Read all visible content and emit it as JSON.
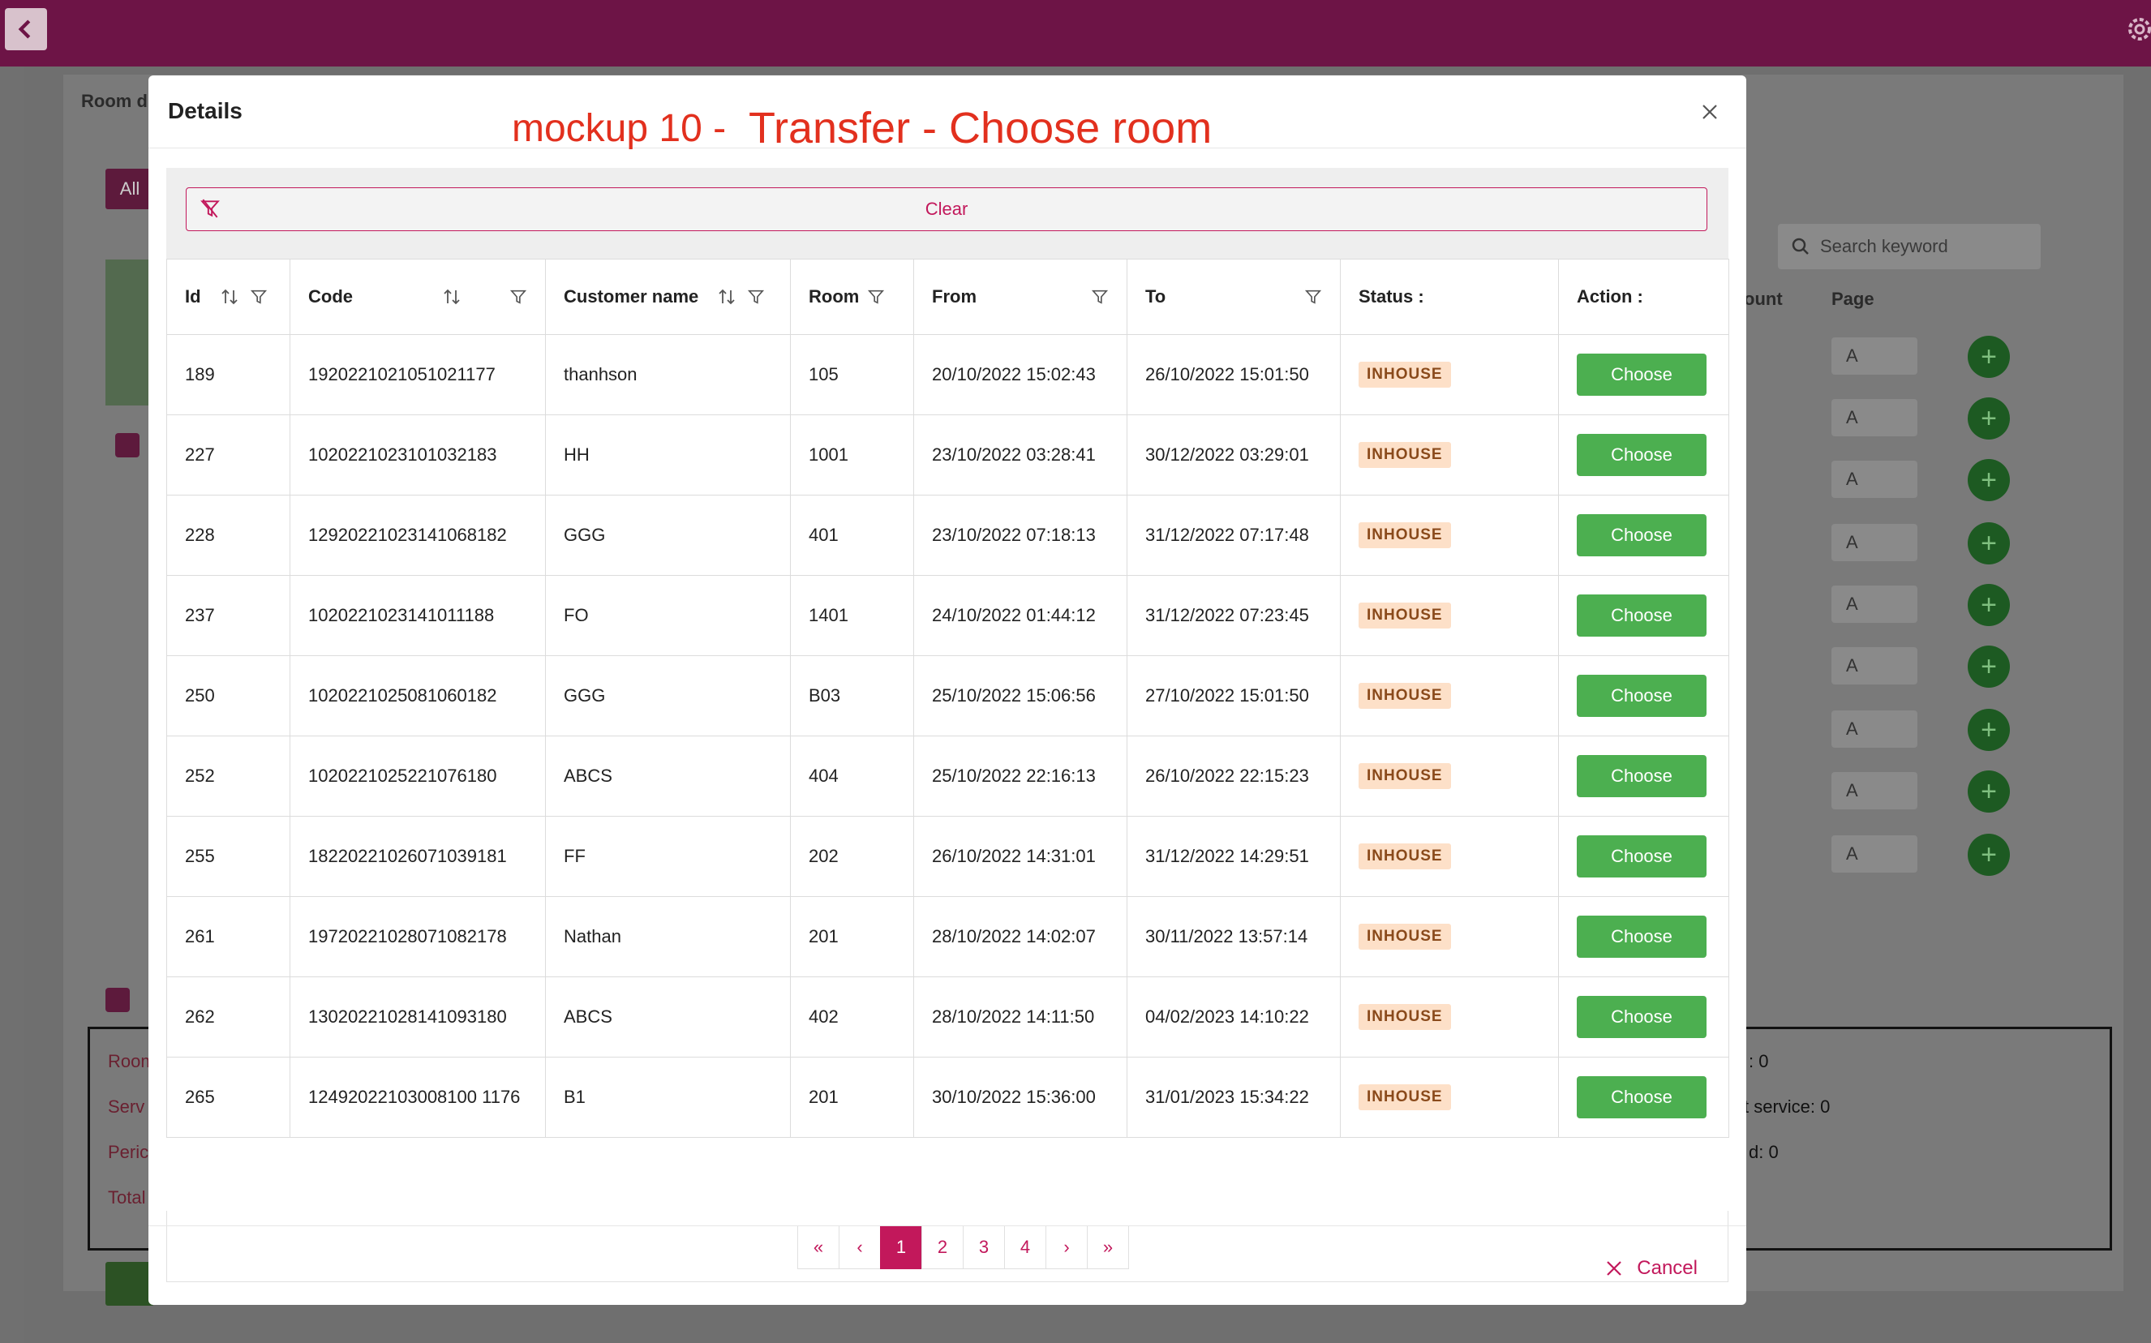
{
  "background": {
    "room_label": "Room d",
    "all_label": "All",
    "search_placeholder": "Search keyword",
    "col_amount": "ount",
    "col_page": "Page",
    "select_value": "A",
    "summary": {
      "labels": [
        "Room",
        "Serv",
        "Peric",
        "Total"
      ],
      "right": [
        ": 0",
        "t service: 0",
        "d: 0"
      ]
    },
    "check_label": "A"
  },
  "modal": {
    "title": "Details",
    "note_left": "mockup 10 -",
    "note_right": "Transfer - Choose room",
    "clear_label": "Clear",
    "cancel_label": "Cancel",
    "columns": {
      "id": "Id",
      "code": "Code",
      "customer": "Customer name",
      "room": "Room",
      "from": "From",
      "to": "To",
      "status": "Status :",
      "action": "Action :"
    },
    "choose_label": "Choose",
    "rows": [
      {
        "id": "189",
        "code": "1920221021051021177",
        "customer": "thanhson",
        "room": "105",
        "from": "20/10/2022 15:02:43",
        "to": "26/10/2022 15:01:50",
        "status": "INHOUSE"
      },
      {
        "id": "227",
        "code": "1020221023101032183",
        "customer": "HH",
        "room": "1001",
        "from": "23/10/2022 03:28:41",
        "to": "30/12/2022 03:29:01",
        "status": "INHOUSE"
      },
      {
        "id": "228",
        "code": "12920221023141068182",
        "customer": "GGG",
        "room": "401",
        "from": "23/10/2022 07:18:13",
        "to": "31/12/2022 07:17:48",
        "status": "INHOUSE"
      },
      {
        "id": "237",
        "code": "1020221023141011188",
        "customer": "FO",
        "room": "1401",
        "from": "24/10/2022 01:44:12",
        "to": "31/12/2022 07:23:45",
        "status": "INHOUSE"
      },
      {
        "id": "250",
        "code": "1020221025081060182",
        "customer": "GGG",
        "room": "B03",
        "from": "25/10/2022 15:06:56",
        "to": "27/10/2022 15:01:50",
        "status": "INHOUSE"
      },
      {
        "id": "252",
        "code": "1020221025221076180",
        "customer": "ABCS",
        "room": "404",
        "from": "25/10/2022 22:16:13",
        "to": "26/10/2022 22:15:23",
        "status": "INHOUSE"
      },
      {
        "id": "255",
        "code": "18220221026071039181",
        "customer": "FF",
        "room": "202",
        "from": "26/10/2022 14:31:01",
        "to": "31/12/2022 14:29:51",
        "status": "INHOUSE"
      },
      {
        "id": "261",
        "code": "19720221028071082178",
        "customer": "Nathan",
        "room": "201",
        "from": "28/10/2022 14:02:07",
        "to": "30/11/2022 13:57:14",
        "status": "INHOUSE"
      },
      {
        "id": "262",
        "code": "13020221028141093180",
        "customer": "ABCS",
        "room": "402",
        "from": "28/10/2022 14:11:50",
        "to": "04/02/2023 14:10:22",
        "status": "INHOUSE"
      },
      {
        "id": "265",
        "code": "12492022103008100 1176",
        "customer": "B1",
        "room": "201",
        "from": "30/10/2022 15:36:00",
        "to": "31/01/2023 15:34:22",
        "status": "INHOUSE"
      }
    ],
    "pagination": {
      "first": "«",
      "prev": "‹",
      "pages": [
        "1",
        "2",
        "3",
        "4"
      ],
      "current": "1",
      "next": "›",
      "last": "»"
    }
  },
  "colors": {
    "brand": "#6d1446",
    "accent": "#c2185b",
    "choose_green": "#4caf50",
    "badge_bg": "#fde0c8",
    "note_red": "#e2301e"
  }
}
